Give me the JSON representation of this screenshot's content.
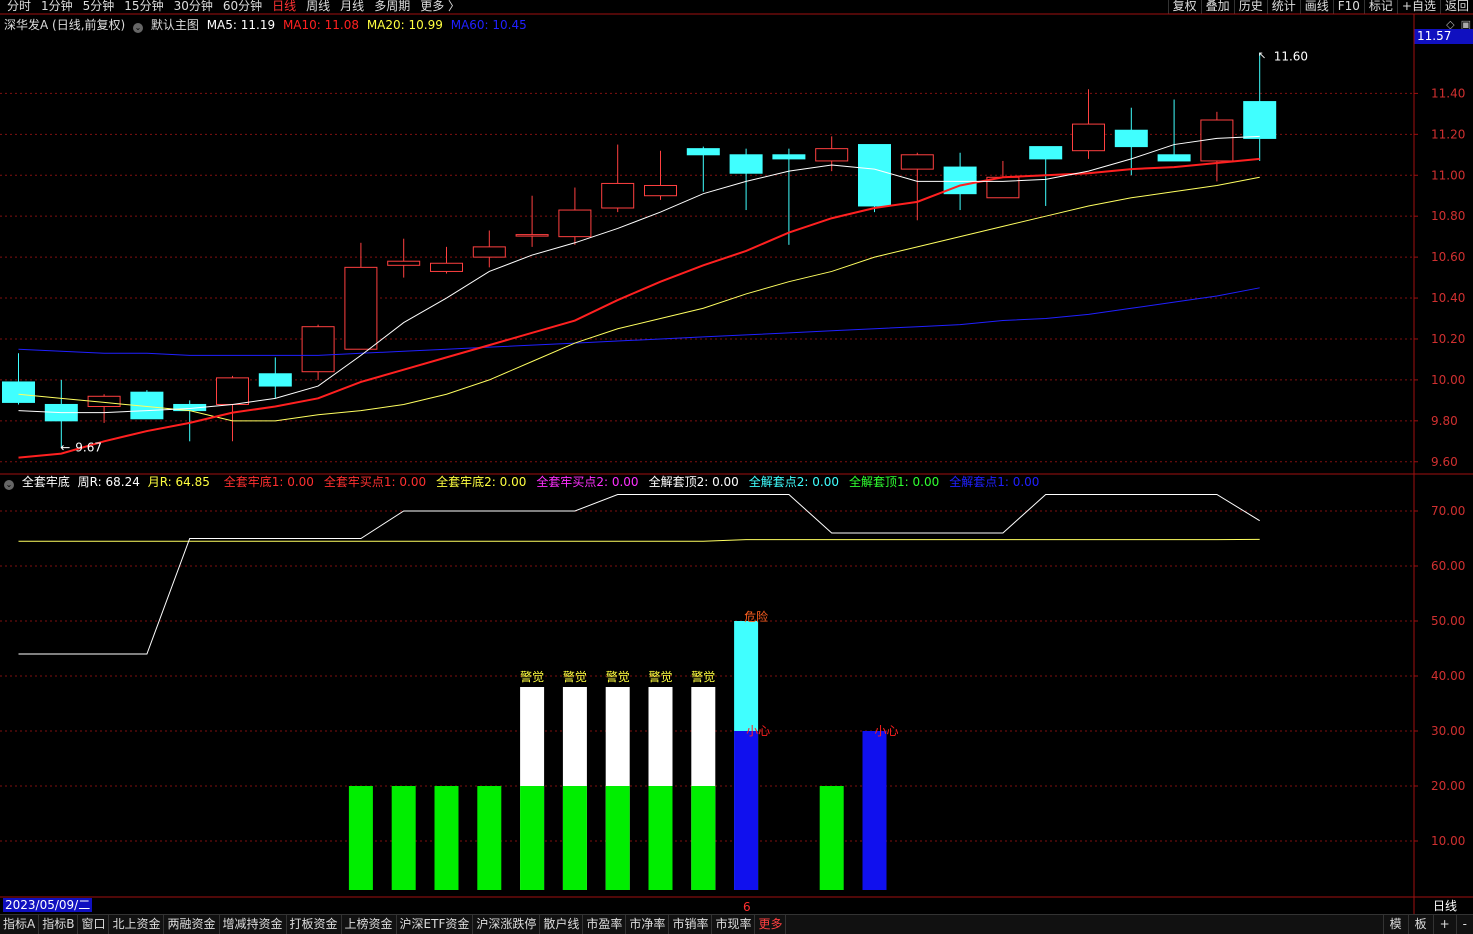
{
  "topbar": {
    "period_tabs": [
      "分时",
      "1分钟",
      "5分钟",
      "15分钟",
      "30分钟",
      "60分钟",
      "日线",
      "周线",
      "月线",
      "多周期",
      "更多 〉"
    ],
    "active_tab": "日线",
    "right_tools": [
      "复权",
      "叠加",
      "历史",
      "统计",
      "画线",
      "F10",
      "标记",
      "+自选",
      "返回"
    ]
  },
  "main_legend": {
    "stock": "深华发A (日线,前复权)",
    "template": "默认主图",
    "ma5": "MA5: 11.19",
    "ma10": "MA10: 11.08",
    "ma20": "MA20: 10.99",
    "ma60": "MA60: 10.45"
  },
  "sub_legend": {
    "name": "全套牢底",
    "zhour": "周R: 68.24",
    "yuer": "月R: 64.85",
    "items": [
      {
        "text": "全套牢底1: 0.00",
        "color": "#ff3030"
      },
      {
        "text": "全套牢买点1: 0.00",
        "color": "#ff3030"
      },
      {
        "text": "全套牢底2: 0.00",
        "color": "#ffff40"
      },
      {
        "text": "全套牢买点2: 0.00",
        "color": "#ff30ff"
      },
      {
        "text": "全解套顶2: 0.00",
        "color": "#ffffff"
      },
      {
        "text": "全解套点2: 0.00",
        "color": "#40ffff"
      },
      {
        "text": "全解套顶1: 0.00",
        "color": "#30ff30"
      },
      {
        "text": "全解套点1: 0.00",
        "color": "#2020ff"
      }
    ]
  },
  "price_axis": {
    "labels": [
      "11.40",
      "11.20",
      "11.00",
      "10.80",
      "10.60",
      "10.40",
      "10.20",
      "10.00",
      "9.80",
      "9.60"
    ],
    "current": "11.57",
    "high_label": "11.60",
    "low_label": "9.67"
  },
  "sub_axis": {
    "labels": [
      "70.00",
      "60.00",
      "50.00",
      "40.00",
      "30.00",
      "20.00",
      "10.00"
    ]
  },
  "colors": {
    "up": "#ff4040",
    "down": "#40ffff",
    "ma5": "#ffffff",
    "ma10": "#ff2020",
    "ma20": "#ffff60",
    "ma60": "#2020ff",
    "grid": "#801010"
  },
  "chart_data": {
    "type": "candlestick",
    "candles": [
      {
        "o": 9.99,
        "h": 10.13,
        "l": 9.88,
        "c": 9.89
      },
      {
        "o": 9.88,
        "h": 10.0,
        "l": 9.67,
        "c": 9.8
      },
      {
        "o": 9.87,
        "h": 9.93,
        "l": 9.79,
        "c": 9.92
      },
      {
        "o": 9.94,
        "h": 9.95,
        "l": 9.81,
        "c": 9.81
      },
      {
        "o": 9.88,
        "h": 9.9,
        "l": 9.7,
        "c": 9.85
      },
      {
        "o": 9.88,
        "h": 10.02,
        "l": 9.7,
        "c": 10.01
      },
      {
        "o": 10.03,
        "h": 10.11,
        "l": 9.91,
        "c": 9.97
      },
      {
        "o": 10.04,
        "h": 10.27,
        "l": 10.0,
        "c": 10.26
      },
      {
        "o": 10.15,
        "h": 10.67,
        "l": 10.15,
        "c": 10.55
      },
      {
        "o": 10.56,
        "h": 10.69,
        "l": 10.5,
        "c": 10.58
      },
      {
        "o": 10.53,
        "h": 10.65,
        "l": 10.52,
        "c": 10.57
      },
      {
        "o": 10.6,
        "h": 10.73,
        "l": 10.55,
        "c": 10.65
      },
      {
        "o": 10.71,
        "h": 10.9,
        "l": 10.65,
        "c": 10.71
      },
      {
        "o": 10.7,
        "h": 10.94,
        "l": 10.66,
        "c": 10.83
      },
      {
        "o": 10.84,
        "h": 11.15,
        "l": 10.82,
        "c": 10.96
      },
      {
        "o": 10.9,
        "h": 11.12,
        "l": 10.88,
        "c": 10.95
      },
      {
        "o": 11.13,
        "h": 11.14,
        "l": 10.92,
        "c": 11.1
      },
      {
        "o": 11.1,
        "h": 11.13,
        "l": 10.83,
        "c": 11.01
      },
      {
        "o": 11.1,
        "h": 11.13,
        "l": 10.66,
        "c": 11.08
      },
      {
        "o": 11.07,
        "h": 11.19,
        "l": 11.02,
        "c": 11.13
      },
      {
        "o": 11.15,
        "h": 11.15,
        "l": 10.82,
        "c": 10.85
      },
      {
        "o": 11.03,
        "h": 11.11,
        "l": 10.78,
        "c": 11.1
      },
      {
        "o": 11.04,
        "h": 11.11,
        "l": 10.83,
        "c": 10.91
      },
      {
        "o": 10.89,
        "h": 11.07,
        "l": 10.89,
        "c": 10.99
      },
      {
        "o": 11.14,
        "h": 11.14,
        "l": 10.85,
        "c": 11.08
      },
      {
        "o": 11.12,
        "h": 11.42,
        "l": 11.08,
        "c": 11.25
      },
      {
        "o": 11.22,
        "h": 11.33,
        "l": 11.0,
        "c": 11.14
      },
      {
        "o": 11.1,
        "h": 11.37,
        "l": 11.07,
        "c": 11.07
      },
      {
        "o": 11.07,
        "h": 11.31,
        "l": 10.97,
        "c": 11.27
      },
      {
        "o": 11.36,
        "h": 11.6,
        "l": 11.07,
        "c": 11.18
      }
    ],
    "ma5": [
      9.85,
      9.84,
      9.84,
      9.85,
      9.86,
      9.88,
      9.91,
      9.97,
      10.12,
      10.28,
      10.4,
      10.53,
      10.61,
      10.67,
      10.74,
      10.82,
      10.91,
      10.97,
      11.02,
      11.05,
      11.03,
      10.97,
      10.97,
      10.97,
      10.98,
      11.02,
      11.08,
      11.15,
      11.18,
      11.19
    ],
    "ma10": [
      9.62,
      9.64,
      9.7,
      9.75,
      9.79,
      9.84,
      9.87,
      9.91,
      9.99,
      10.05,
      10.11,
      10.17,
      10.23,
      10.29,
      10.39,
      10.48,
      10.56,
      10.63,
      10.72,
      10.79,
      10.84,
      10.87,
      10.95,
      10.99,
      11.0,
      11.01,
      11.03,
      11.04,
      11.06,
      11.08
    ],
    "ma20": [
      9.93,
      9.91,
      9.89,
      9.87,
      9.85,
      9.8,
      9.8,
      9.83,
      9.85,
      9.88,
      9.93,
      10.0,
      10.09,
      10.18,
      10.25,
      10.3,
      10.35,
      10.42,
      10.48,
      10.53,
      10.6,
      10.65,
      10.7,
      10.75,
      10.8,
      10.85,
      10.89,
      10.92,
      10.95,
      10.99
    ],
    "ma60": [
      10.15,
      10.14,
      10.13,
      10.13,
      10.12,
      10.12,
      10.12,
      10.12,
      10.13,
      10.14,
      10.15,
      10.16,
      10.17,
      10.18,
      10.19,
      10.2,
      10.21,
      10.22,
      10.23,
      10.24,
      10.25,
      10.26,
      10.27,
      10.29,
      10.3,
      10.32,
      10.35,
      10.38,
      10.41,
      10.45
    ],
    "zhour": [
      44,
      44,
      44,
      44,
      65,
      65,
      65,
      65,
      65,
      70,
      70,
      70,
      70,
      70,
      73,
      73,
      73,
      73,
      73,
      66,
      66,
      66,
      66,
      66,
      73,
      73,
      73,
      73,
      73,
      68.24
    ],
    "yuer": [
      64.5,
      64.5,
      64.5,
      64.5,
      64.5,
      64.5,
      64.5,
      64.5,
      64.5,
      64.5,
      64.5,
      64.5,
      64.5,
      64.5,
      64.5,
      64.5,
      64.5,
      64.8,
      64.8,
      64.8,
      64.8,
      64.8,
      64.8,
      64.8,
      64.8,
      64.8,
      64.8,
      64.8,
      64.8,
      64.85
    ],
    "bars": [
      {
        "idx": 8,
        "green": 20,
        "white": 0,
        "cyan": 0,
        "blue": 0,
        "label": ""
      },
      {
        "idx": 9,
        "green": 20,
        "white": 0,
        "cyan": 0,
        "blue": 0,
        "label": ""
      },
      {
        "idx": 10,
        "green": 20,
        "white": 0,
        "cyan": 0,
        "blue": 0,
        "label": ""
      },
      {
        "idx": 11,
        "green": 20,
        "white": 0,
        "cyan": 0,
        "blue": 0,
        "label": ""
      },
      {
        "idx": 12,
        "green": 20,
        "white": 38,
        "cyan": 0,
        "blue": 0,
        "label": "警觉"
      },
      {
        "idx": 13,
        "green": 20,
        "white": 38,
        "cyan": 0,
        "blue": 0,
        "label": "警觉"
      },
      {
        "idx": 14,
        "green": 20,
        "white": 38,
        "cyan": 0,
        "blue": 0,
        "label": "警觉"
      },
      {
        "idx": 15,
        "green": 20,
        "white": 38,
        "cyan": 0,
        "blue": 0,
        "label": "警觉"
      },
      {
        "idx": 16,
        "green": 20,
        "white": 38,
        "cyan": 0,
        "blue": 0,
        "label": "警觉"
      },
      {
        "idx": 17,
        "green": 0,
        "white": 0,
        "cyan": 50,
        "blue": 30,
        "label": "危险",
        "label2": "小心"
      },
      {
        "idx": 19,
        "green": 20,
        "white": 0,
        "cyan": 0,
        "blue": 0,
        "label": ""
      },
      {
        "idx": 20,
        "green": 0,
        "white": 0,
        "cyan": 0,
        "blue": 30,
        "label": "",
        "label2": "小心"
      }
    ],
    "price_range": [
      9.55,
      11.7
    ],
    "sub_range": [
      0,
      76
    ]
  },
  "status": {
    "date": "2023/05/09/二",
    "period": "日线",
    "marker": "6"
  },
  "bottom_tabs": [
    "指标A",
    "指标B",
    "窗口",
    "北上资金",
    "两融资金",
    "增减持资金",
    "打板资金",
    "上榜资金",
    "沪深ETF资金",
    "沪深涨跌停",
    "散户线",
    "市盈率",
    "市净率",
    "市销率",
    "市现率",
    "更多"
  ],
  "bottom_right": [
    "模",
    "板",
    "+",
    "-"
  ]
}
